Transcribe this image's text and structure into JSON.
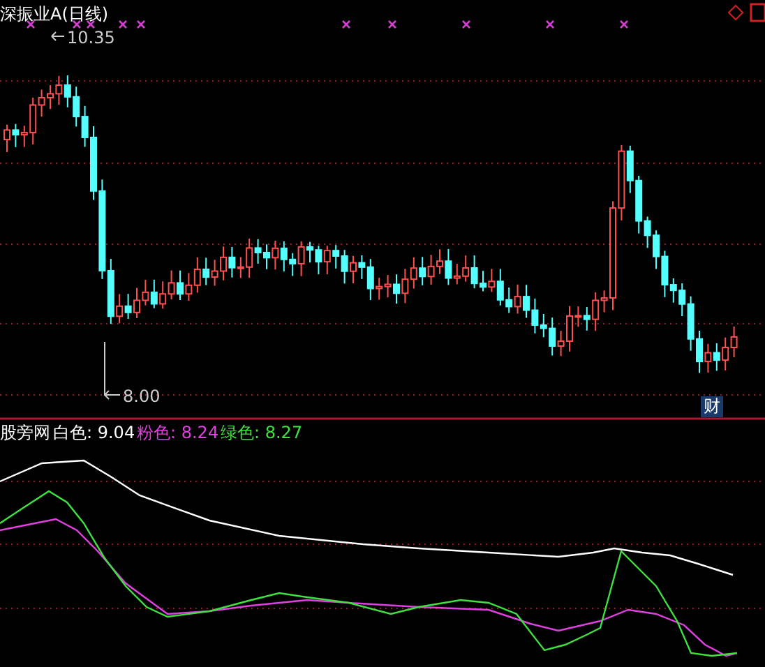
{
  "chart_title": "深振业A(日线)",
  "max_price_label": "10.35",
  "min_price_label": "8.00",
  "event_badge": "财",
  "indicator": {
    "name": "股旁网",
    "readings": [
      {
        "label": "白色:",
        "value": "9.04",
        "color": "#ffffff"
      },
      {
        "label": "粉色:",
        "value": "8.24",
        "color": "#e040e0"
      },
      {
        "label": "绿色:",
        "value": "8.27",
        "color": "#40e040"
      }
    ]
  }
}
